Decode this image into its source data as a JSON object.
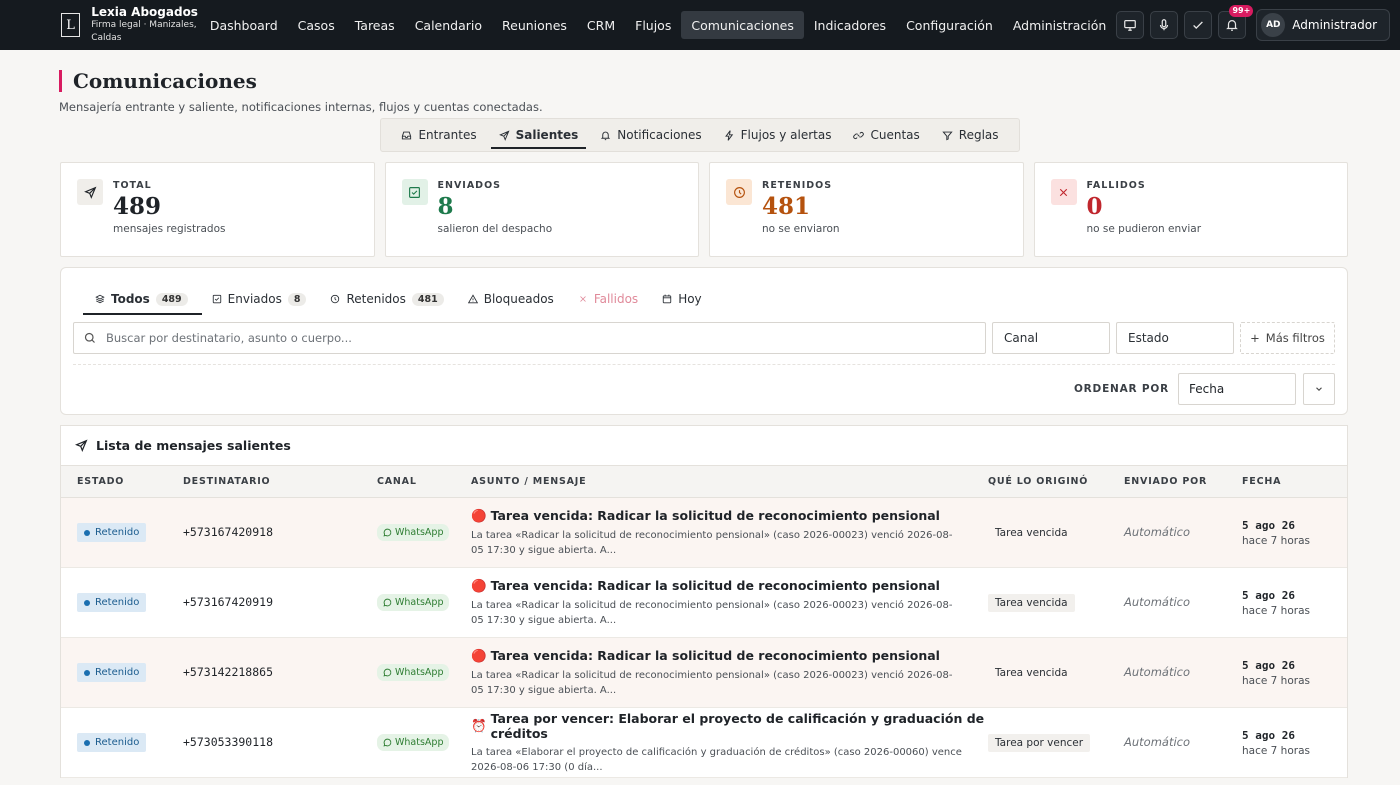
{
  "brand": {
    "logo": "L",
    "name": "Lexia Abogados",
    "subtitle": "Firma legal · Manizales, Caldas"
  },
  "nav": [
    {
      "label": "Dashboard",
      "active": false
    },
    {
      "label": "Casos",
      "active": false
    },
    {
      "label": "Tareas",
      "active": false
    },
    {
      "label": "Calendario",
      "active": false
    },
    {
      "label": "Reuniones",
      "active": false
    },
    {
      "label": "CRM",
      "active": false
    },
    {
      "label": "Flujos",
      "active": false
    },
    {
      "label": "Comunicaciones",
      "active": true
    },
    {
      "label": "Indicadores",
      "active": false
    },
    {
      "label": "Configuración",
      "active": false
    },
    {
      "label": "Administración",
      "active": false
    }
  ],
  "top_actions": {
    "notifications_badge": "99+",
    "user_initials": "AD",
    "user_name": "Administrador"
  },
  "page": {
    "title": "Comunicaciones",
    "subtitle": "Mensajería entrante y saliente, notificaciones internas, flujos y cuentas conectadas."
  },
  "tabs": [
    {
      "label": "Entrantes",
      "icon": "inbox-icon",
      "active": false
    },
    {
      "label": "Salientes",
      "icon": "send-icon",
      "active": true
    },
    {
      "label": "Notificaciones",
      "icon": "bell-icon",
      "active": false
    },
    {
      "label": "Flujos y alertas",
      "icon": "bolt-icon",
      "active": false
    },
    {
      "label": "Cuentas",
      "icon": "link-icon",
      "active": false
    },
    {
      "label": "Reglas",
      "icon": "filter-icon",
      "active": false
    }
  ],
  "stats": [
    {
      "label": "TOTAL",
      "value": "489",
      "note": "mensajes registrados",
      "color": "#1f2328",
      "icon": "send-icon"
    },
    {
      "label": "ENVIADOS",
      "value": "8",
      "note": "salieron del despacho",
      "color": "#1e7a4c",
      "icon": "check-square-icon"
    },
    {
      "label": "RETENIDOS",
      "value": "481",
      "note": "no se enviaron",
      "color": "#b5520e",
      "icon": "clock-icon"
    },
    {
      "label": "FALLIDOS",
      "value": "0",
      "note": "no se pudieron enviar",
      "color": "#c0262d",
      "icon": "x-icon"
    }
  ],
  "filter_tabs": [
    {
      "label": "Todos",
      "count": "489",
      "active": true
    },
    {
      "label": "Enviados",
      "count": "8",
      "active": false
    },
    {
      "label": "Retenidos",
      "count": "481",
      "active": false
    },
    {
      "label": "Bloqueados",
      "count": "",
      "active": false
    },
    {
      "label": "Fallidos",
      "count": "",
      "active": false,
      "disabled": true
    },
    {
      "label": "Hoy",
      "count": "",
      "active": false
    }
  ],
  "filters": {
    "search_placeholder": "Buscar por destinatario, asunto o cuerpo...",
    "canal": "Canal",
    "estado": "Estado",
    "more": "Más filtros",
    "sort_label": "ORDENAR POR",
    "sort_value": "Fecha"
  },
  "list": {
    "title": "Lista de mensajes salientes",
    "columns": [
      "ESTADO",
      "DESTINATARIO",
      "CANAL",
      "ASUNTO / MENSAJE",
      "QUÉ LO ORIGINÓ",
      "ENVIADO POR",
      "FECHA"
    ],
    "rows": [
      {
        "estado": "Retenido",
        "destinatario": "+573167420918",
        "canal": "WhatsApp",
        "emoji": "🔴",
        "asunto": "Tarea vencida: Radicar la solicitud de reconocimiento pensional",
        "cuerpo": "La tarea «Radicar la solicitud de reconocimiento pensional» (caso 2026-00023) venció 2026-08-05 17:30 y sigue abierta. A...",
        "origen": "Tarea vencida",
        "por": "Automático",
        "fecha": "5 ago 26",
        "relativo": "hace 7 horas",
        "shade": true
      },
      {
        "estado": "Retenido",
        "destinatario": "+573167420919",
        "canal": "WhatsApp",
        "emoji": "🔴",
        "asunto": "Tarea vencida: Radicar la solicitud de reconocimiento pensional",
        "cuerpo": "La tarea «Radicar la solicitud de reconocimiento pensional» (caso 2026-00023) venció 2026-08-05 17:30 y sigue abierta. A...",
        "origen": "Tarea vencida",
        "por": "Automático",
        "fecha": "5 ago 26",
        "relativo": "hace 7 horas",
        "shade": false
      },
      {
        "estado": "Retenido",
        "destinatario": "+573142218865",
        "canal": "WhatsApp",
        "emoji": "🔴",
        "asunto": "Tarea vencida: Radicar la solicitud de reconocimiento pensional",
        "cuerpo": "La tarea «Radicar la solicitud de reconocimiento pensional» (caso 2026-00023) venció 2026-08-05 17:30 y sigue abierta. A...",
        "origen": "Tarea vencida",
        "por": "Automático",
        "fecha": "5 ago 26",
        "relativo": "hace 7 horas",
        "shade": true
      },
      {
        "estado": "Retenido",
        "destinatario": "+573053390118",
        "canal": "WhatsApp",
        "emoji": "⏰",
        "asunto": "Tarea por vencer: Elaborar el proyecto de calificación y graduación de créditos",
        "cuerpo": "La tarea «Elaborar el proyecto de calificación y graduación de créditos» (caso 2026-00060) vence 2026-08-06 17:30 (0 día...",
        "origen": "Tarea por vencer",
        "por": "Automático",
        "fecha": "5 ago 26",
        "relativo": "hace 7 horas",
        "shade": false
      }
    ]
  }
}
